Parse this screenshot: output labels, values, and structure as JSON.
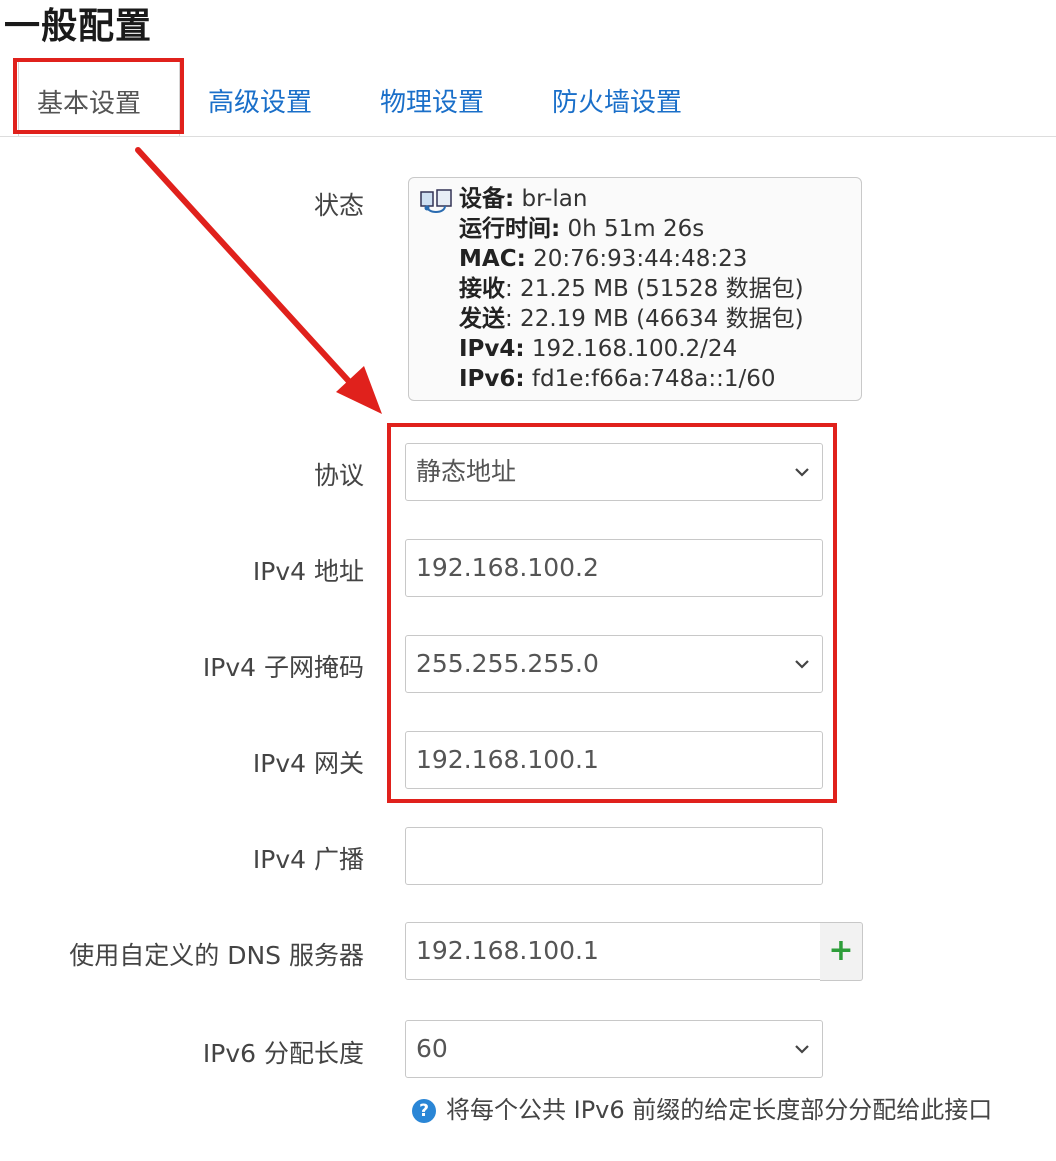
{
  "section_title": "一般配置",
  "tabs": [
    {
      "label": "基本设置",
      "active": true
    },
    {
      "label": "高级设置",
      "active": false
    },
    {
      "label": "物理设置",
      "active": false
    },
    {
      "label": "防火墙设置",
      "active": false
    }
  ],
  "status": {
    "label": "状态",
    "device_key": "设备:",
    "device_val": " br-lan",
    "uptime_key": "运行时间:",
    "uptime_val": " 0h 51m 26s",
    "mac_key": "MAC:",
    "mac_val": " 20:76:93:44:48:23",
    "rx_key": "接收",
    "rx_val": ": 21.25 MB (51528 数据包)",
    "tx_key": "发送",
    "tx_val": ": 22.19 MB (46634 数据包)",
    "ipv4_key": "IPv4:",
    "ipv4_val": " 192.168.100.2/24",
    "ipv6_key": "IPv6:",
    "ipv6_val": " fd1e:f66a:748a::1/60"
  },
  "form": {
    "protocol": {
      "label": "协议",
      "value": "静态地址"
    },
    "ipv4_addr": {
      "label": "IPv4 地址",
      "value": "192.168.100.2"
    },
    "ipv4_mask": {
      "label": "IPv4 子网掩码",
      "value": "255.255.255.0"
    },
    "ipv4_gw": {
      "label": "IPv4 网关",
      "value": "192.168.100.1"
    },
    "ipv4_bcast": {
      "label": "IPv4 广播",
      "value": ""
    },
    "dns": {
      "label": "使用自定义的 DNS 服务器",
      "value": "192.168.100.1",
      "add_label": "+"
    },
    "ipv6_len": {
      "label": "IPv6 分配长度",
      "value": "60",
      "help": "将每个公共 IPv6 前缀的给定长度部分分配给此接口"
    }
  },
  "colors": {
    "link": "#1a6fc9",
    "highlight": "#e0211c",
    "add": "#2e9e3a",
    "help": "#2a86d6"
  }
}
